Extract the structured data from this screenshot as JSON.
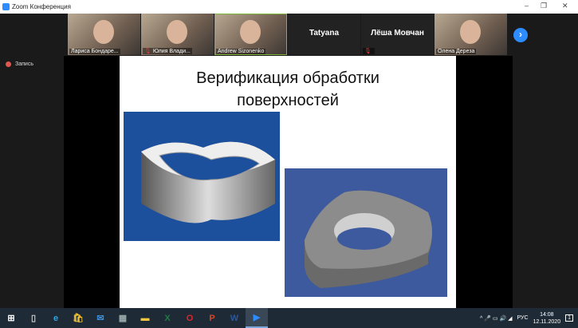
{
  "window": {
    "title": "Zoom Конференция",
    "minimize": "–",
    "restore": "❐",
    "close": "✕"
  },
  "participants": [
    {
      "name": "Лариса Бондаре...",
      "video": true,
      "muted": false
    },
    {
      "name": "Юлия Влади...",
      "video": true,
      "muted": true
    },
    {
      "name": "Andrew Sizonenko",
      "video": true,
      "muted": false,
      "active": true
    },
    {
      "name": "Tatyana",
      "video": false,
      "muted": false
    },
    {
      "name": "Лёша Мовчан",
      "video": false,
      "muted": true
    },
    {
      "name": "Олена Дереза",
      "video": true,
      "muted": false
    }
  ],
  "next_label": "›",
  "recording": "Запись",
  "slide": {
    "title_line1": "Верификация обработки",
    "title_line2": "поверхностей"
  },
  "taskbar": {
    "apps": [
      "start",
      "task-view",
      "edge",
      "store",
      "mail",
      "calculator",
      "explorer",
      "excel",
      "opera",
      "powerpoint",
      "word",
      "zoom"
    ],
    "glyphs": [
      "⊞",
      "▯",
      "e",
      "🛍",
      "✉",
      "▦",
      "▬",
      "X",
      "O",
      "P",
      "W",
      "▶"
    ],
    "colors": [
      "#fff",
      "#ccc",
      "#2fa5e6",
      "#f1c232",
      "#3b8fd9",
      "#9aa",
      "#f4c542",
      "#1f7a45",
      "#e0262c",
      "#d24726",
      "#2b579a",
      "#2d8cff"
    ],
    "tray": {
      "lang": "РУС",
      "time": "14:08",
      "date": "12.11.2020",
      "notifications": "1",
      "icons": "^ 🎤 ▭ 🔊 ◢"
    }
  }
}
